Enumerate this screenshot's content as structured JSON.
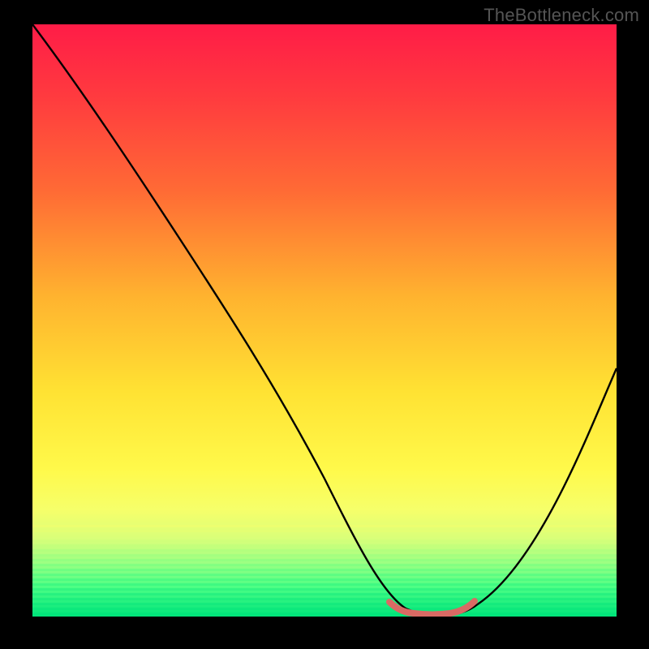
{
  "watermark": "TheBottleneck.com",
  "colors": {
    "frame_bg": "#000000",
    "curve_stroke": "#000000",
    "marker_stroke": "#d96a64",
    "watermark": "#555555"
  },
  "chart_data": {
    "type": "line",
    "title": "",
    "xlabel": "",
    "ylabel": "",
    "xlim": [
      0,
      100
    ],
    "ylim": [
      0,
      100
    ],
    "grid": false,
    "legend": false,
    "series": [
      {
        "name": "bottleneck-curve",
        "x": [
          0,
          8,
          16,
          24,
          32,
          40,
          48,
          56,
          60,
          64,
          68,
          72,
          76,
          80,
          84,
          88,
          92,
          96,
          100
        ],
        "values": [
          100,
          88,
          76,
          64,
          52,
          40,
          28,
          16,
          8,
          2,
          0,
          0,
          2,
          6,
          12,
          20,
          28,
          36,
          44
        ]
      }
    ],
    "marker": {
      "name": "optimal-range",
      "x_start": 60,
      "x_end": 74,
      "y": 2
    },
    "gradient_stops": [
      {
        "pos": 0.0,
        "color": "#ff1c47"
      },
      {
        "pos": 0.12,
        "color": "#ff3a3f"
      },
      {
        "pos": 0.28,
        "color": "#ff6a35"
      },
      {
        "pos": 0.46,
        "color": "#ffb32f"
      },
      {
        "pos": 0.62,
        "color": "#ffe233"
      },
      {
        "pos": 0.75,
        "color": "#fff94a"
      },
      {
        "pos": 0.82,
        "color": "#f6ff6a"
      },
      {
        "pos": 0.87,
        "color": "#d8ff7a"
      },
      {
        "pos": 0.91,
        "color": "#9bff82"
      },
      {
        "pos": 0.95,
        "color": "#4dff85"
      },
      {
        "pos": 1.0,
        "color": "#00e57a"
      }
    ]
  }
}
